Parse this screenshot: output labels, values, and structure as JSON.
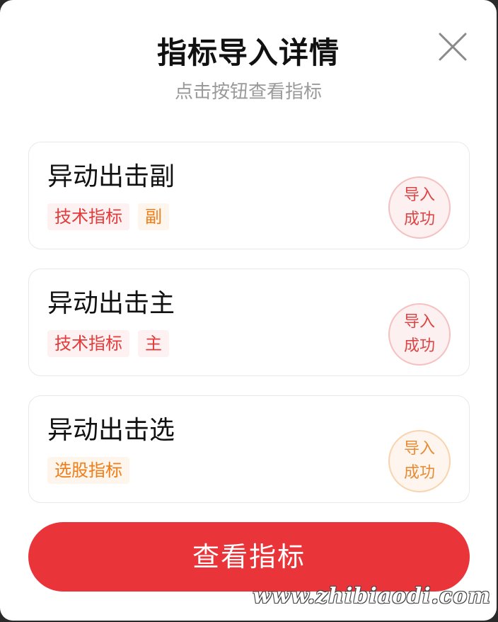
{
  "dialog": {
    "title": "指标导入详情",
    "subtitle": "点击按钮查看指标",
    "close_icon": "close-icon"
  },
  "items": [
    {
      "name": "异动出击副",
      "tags": [
        "技术指标",
        "副"
      ],
      "status": [
        "导入",
        "成功"
      ],
      "status_color": "#dc4545"
    },
    {
      "name": "异动出击主",
      "tags": [
        "技术指标",
        "主"
      ],
      "status": [
        "导入",
        "成功"
      ],
      "status_color": "#dc4545"
    },
    {
      "name": "异动出击选",
      "tags": [
        "选股指标"
      ],
      "status": [
        "导入",
        "成功"
      ],
      "status_color": "#ea8a33"
    }
  ],
  "actions": {
    "view_label": "查看指标",
    "button_color": "#e9343a"
  },
  "watermark": "www.zhibiaodi.com"
}
